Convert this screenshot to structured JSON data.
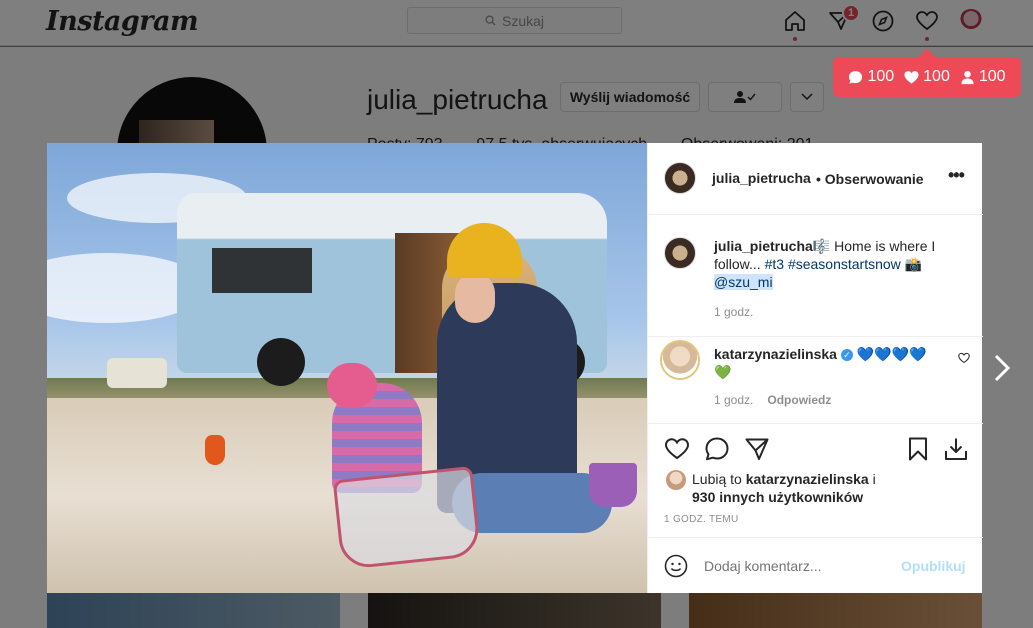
{
  "nav": {
    "logo": "Instagram",
    "search_placeholder": "Szukaj",
    "notifications_badge": "1"
  },
  "activity": {
    "comments": "100",
    "likes": "100",
    "followers": "100"
  },
  "profile": {
    "username": "julia_pietrucha",
    "message_button": "Wyślij wiadomość",
    "more": "···",
    "stats_partial": "Posty: 793 · · · 97,5 tys. obserwujących · · · Obserwowani: 201"
  },
  "post": {
    "author": "julia_pietrucha",
    "follow_state": "• Obserwowanie",
    "more": "•••",
    "caption_user": "julia_pietrucha",
    "caption_line1": "🎼 Home is where I",
    "caption_line2a": "follow... ",
    "caption_tag1": "#t3",
    "caption_tag2": "#seasonstartsnow",
    "caption_emoji": " 📸",
    "caption_mention": "@szu_mi",
    "caption_time": "1 godz.",
    "comment_user": "katarzynazielinska",
    "comment_text": " 💙💙💙💙",
    "comment_text2": "💚",
    "comment_time": "1 godz.",
    "comment_reply": "Odpowiedz",
    "likes_prefix": "Lubią to ",
    "likes_user": "katarzynazielinska",
    "likes_mid": " i",
    "likes_others": "930 innych użytkowników",
    "timestamp": "1 GODZ. TEMU",
    "comment_placeholder": "Dodaj komentarz...",
    "post_button": "Opublikuj"
  },
  "colors": {
    "accent_blue": "#0095f6",
    "notification_red": "#ed4956",
    "link_blue": "#00376b"
  }
}
